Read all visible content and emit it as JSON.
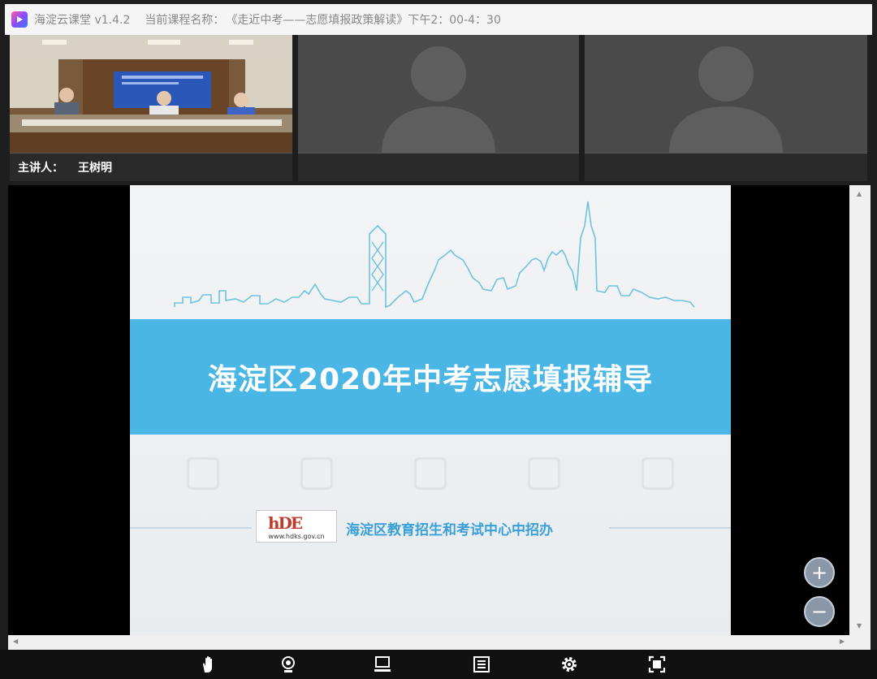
{
  "titlebar": {
    "app_name": "海淀云课堂 v1.4.2",
    "course_label": "当前课程名称：",
    "course_title": "《走近中考——志愿填报政策解读》下午2：00-4：30"
  },
  "videos": [
    {
      "presenter_label": "主讲人：",
      "presenter_name": "王树明"
    },
    {
      "presenter_label": "",
      "presenter_name": ""
    },
    {
      "presenter_label": "",
      "presenter_name": ""
    }
  ],
  "slide": {
    "title": "海淀区2020年中考志愿填报辅导",
    "logo_text": "hDE",
    "logo_url": "www.hdks.gov.cn",
    "org_name": "海淀区教育招生和考试中心中招办"
  },
  "zoom": {
    "in_label": "+",
    "out_label": "−"
  },
  "toolbar": {
    "icons": [
      "raise-hand-icon",
      "camera-icon",
      "laptop-icon",
      "document-list-icon",
      "gear-icon",
      "fullscreen-icon"
    ]
  },
  "colors": {
    "banner": "#49b6e6",
    "org_name": "#3aa0d8",
    "logo_red": "#c0392b"
  }
}
